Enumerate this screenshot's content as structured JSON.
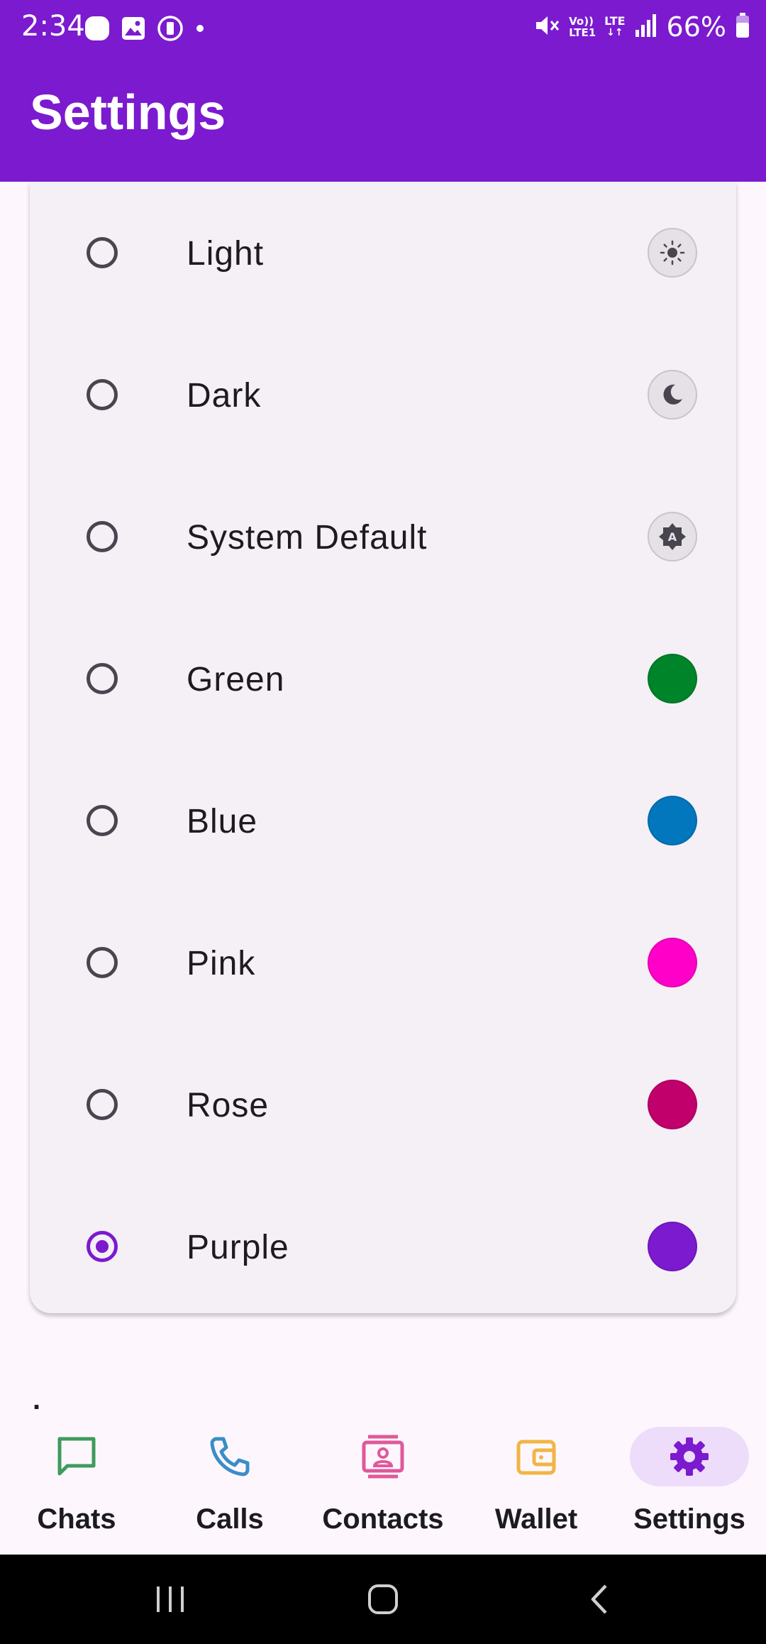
{
  "status_bar": {
    "time": "2:34",
    "battery": "66%",
    "left_icons": [
      "notification-dot-icon",
      "gallery-icon",
      "screen-record-icon",
      "more-dot-icon"
    ],
    "right_icons": [
      "mute-icon",
      "volte-icon",
      "lte-icon",
      "signal-icon",
      "battery-icon"
    ],
    "volte_label_top": "Vo))",
    "volte_label_bottom": "LTE1",
    "lte_label": "LTE"
  },
  "header": {
    "title": "Settings",
    "color": "#7B1ACF"
  },
  "theme_options": [
    {
      "label": "Light",
      "selected": false,
      "icon": "sun-icon"
    },
    {
      "label": "Dark",
      "selected": false,
      "icon": "moon-icon"
    },
    {
      "label": "System Default",
      "selected": false,
      "icon": "auto-brightness-icon",
      "icon_text": "A"
    }
  ],
  "color_options": [
    {
      "label": "Green",
      "selected": false,
      "color": "#00842A"
    },
    {
      "label": "Blue",
      "selected": false,
      "color": "#0277BD"
    },
    {
      "label": "Pink",
      "selected": false,
      "color": "#FF00C8"
    },
    {
      "label": "Rose",
      "selected": false,
      "color": "#C2006C"
    },
    {
      "label": "Purple",
      "selected": true,
      "color": "#7B1ACF"
    }
  ],
  "footer_text": ".",
  "bottom_nav": [
    {
      "label": "Chats",
      "icon": "chat-bubble-icon",
      "color": "#3E9B5C",
      "active": false
    },
    {
      "label": "Calls",
      "icon": "phone-icon",
      "color": "#3B8DC7",
      "active": false
    },
    {
      "label": "Contacts",
      "icon": "contacts-icon",
      "color": "#E0589A",
      "active": false
    },
    {
      "label": "Wallet",
      "icon": "wallet-icon",
      "color": "#F2B544",
      "active": false
    },
    {
      "label": "Settings",
      "icon": "gear-icon",
      "color": "#7B1ACF",
      "active": true
    }
  ],
  "system_nav": [
    "recents-icon",
    "home-icon",
    "back-icon"
  ]
}
